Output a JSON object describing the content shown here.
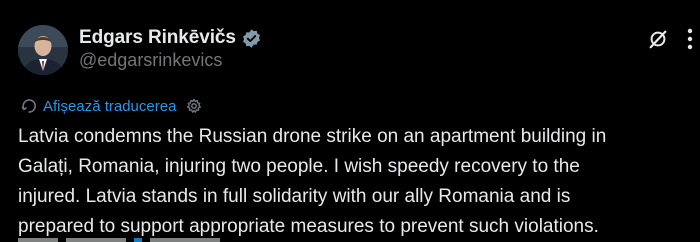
{
  "author": {
    "display_name": "Edgars Rinkēvičs",
    "handle": "@edgarsrinkevics",
    "verified_icon": "verified-badge-icon"
  },
  "header_actions": {
    "grok_icon": "grok-icon",
    "more_icon": "more-vertical-icon"
  },
  "translate": {
    "label": "Afișează traducerea",
    "icon": "translate-icon",
    "settings_icon": "settings-icon"
  },
  "post": {
    "lines": [
      "Latvia condemns the Russian drone strike on an apartment building in",
      "Galați, Romania, injuring two people. I wish speedy recovery to the",
      "injured. Latvia stands in full solidarity with our ally Romania and is",
      "prepared to support appropriate measures to prevent such violations."
    ]
  },
  "colors": {
    "background": "#000000",
    "text": "#e7e9ea",
    "secondary": "#71767b",
    "accent": "#1d9bf0"
  }
}
